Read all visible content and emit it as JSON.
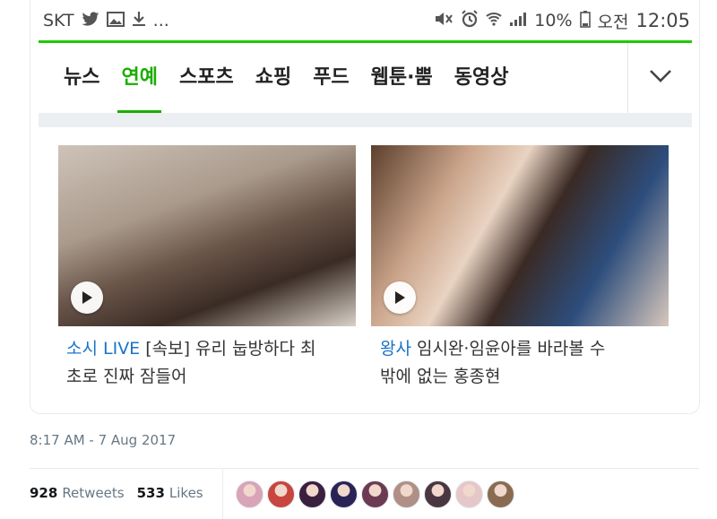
{
  "statusbar": {
    "carrier": "SKT",
    "left_icons": [
      "twitter-icon",
      "image-icon",
      "download-icon"
    ],
    "ellipsis": "...",
    "battery": "10%",
    "ampm": "오전",
    "time": "12:05"
  },
  "tabs": [
    {
      "label": "뉴스",
      "active": false
    },
    {
      "label": "연예",
      "active": true
    },
    {
      "label": "스포츠",
      "active": false
    },
    {
      "label": "쇼핑",
      "active": false
    },
    {
      "label": "푸드",
      "active": false
    },
    {
      "label": "웹툰·뿜",
      "active": false
    },
    {
      "label": "동영상",
      "active": false
    }
  ],
  "videos": [
    {
      "category": "소시 LIVE",
      "title": "[속보] 유리 눕방하다 최",
      "title_line2": "초로 진짜 잠들어"
    },
    {
      "category": "왕사",
      "title": "임시완·임윤아를 바라볼 수",
      "title_line2": "밖에 없는 홍종현"
    }
  ],
  "tweet": {
    "timestamp": "8:17 AM - 7 Aug 2017",
    "retweets_count": "928",
    "retweets_label": "Retweets",
    "likes_count": "533",
    "likes_label": "Likes"
  },
  "colors": {
    "accent_green": "#19ae00",
    "status_line": "#1ec800",
    "category_blue": "#1a73c8",
    "avatars": [
      "#d9a3b8",
      "#c9453f",
      "#3b1f3e",
      "#2a2356",
      "#6c3a52",
      "#b08f86",
      "#4a3640",
      "#e6c7c9",
      "#8a6b52"
    ]
  }
}
